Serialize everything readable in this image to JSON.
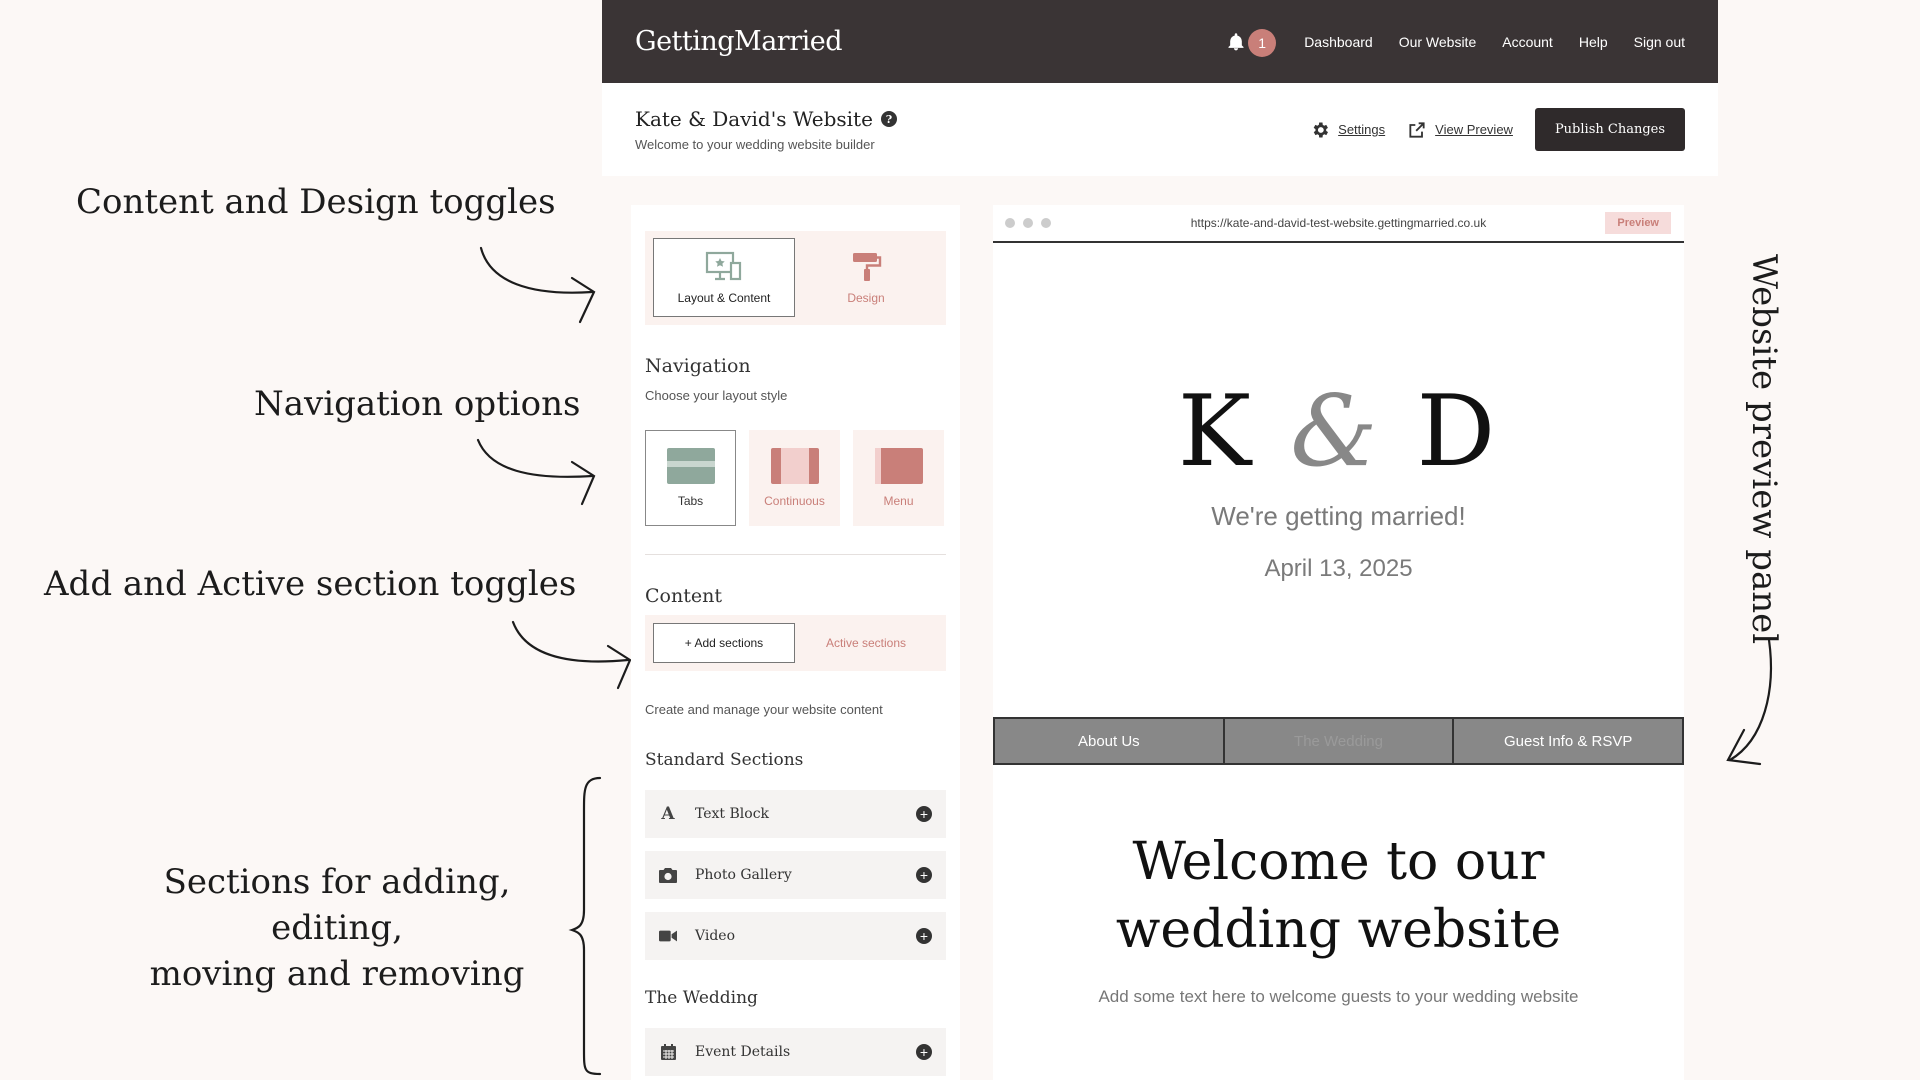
{
  "annotations": {
    "content_design": "Content and Design toggles",
    "navigation": "Navigation options",
    "add_active": "Add and Active section toggles",
    "sections_line1": "Sections for adding, editing,",
    "sections_line2": "moving and removing",
    "preview_panel": "Website preview panel"
  },
  "topbar": {
    "logo": "GettingMarried",
    "notification_count": "1",
    "nav": [
      "Dashboard",
      "Our Website",
      "Account",
      "Help",
      "Sign out"
    ]
  },
  "header": {
    "title": "Kate & David's Website",
    "subtitle": "Welcome to your wedding website builder",
    "settings_label": "Settings",
    "view_preview_label": "View Preview",
    "publish_label": "Publish Changes"
  },
  "left_panel": {
    "toggles": {
      "layout_content": "Layout & Content",
      "design": "Design"
    },
    "navigation": {
      "title": "Navigation",
      "subtitle": "Choose your layout style",
      "options": [
        "Tabs",
        "Continuous",
        "Menu"
      ]
    },
    "content": {
      "title": "Content",
      "add_sections": "+ Add sections",
      "active_sections": "Active sections",
      "description": "Create and manage your website content"
    },
    "standard_sections": {
      "title": "Standard Sections",
      "items": [
        "Text Block",
        "Photo Gallery",
        "Video"
      ]
    },
    "the_wedding": {
      "title": "The Wedding",
      "items": [
        "Event Details"
      ]
    }
  },
  "preview": {
    "url": "https://kate-and-david-test-website.gettingmarried.co.uk",
    "tag": "Preview",
    "monogram_left": "K",
    "monogram_amp": "&",
    "monogram_right": "D",
    "tagline": "We're getting married!",
    "date": "April 13, 2025",
    "tabs": [
      "About Us",
      "The Wedding",
      "Guest Info & RSVP"
    ],
    "welcome_line1": "Welcome to our",
    "welcome_line2": "wedding website",
    "welcome_sub": "Add some text here to welcome guests to your wedding website"
  },
  "colors": {
    "topbar": "#3a3435",
    "accent": "#c97f79",
    "accent_soft": "#fbf2ef",
    "sage": "#8fa89c"
  }
}
